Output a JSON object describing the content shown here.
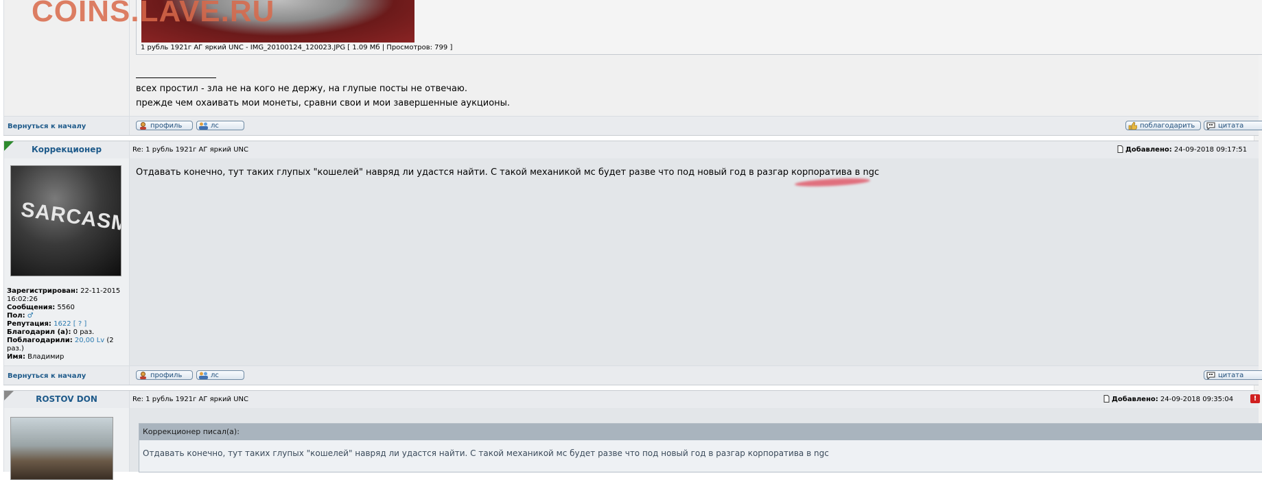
{
  "site": {
    "watermark": "COINS.LAVE.RU",
    "back_to_top": "Вернуться к началу"
  },
  "colors": {
    "accent": "#1e5a8a",
    "link": "#2a7ab0",
    "watermark": "#d9694a"
  },
  "first_post": {
    "attachment_caption": "1 рубль 1921г АГ яркий UNC - IMG_20100124_120023.JPG [ 1.09 Мб | Просмотров: 799 ]",
    "signature_rule": "____________________",
    "signature_line1": "всех простил - зла не на кого не держу, на глупые посты не отвечаю.",
    "signature_line2": "прежде чем охаивать мои монеты, сравни свои и мои завершенные аукционы.",
    "buttons": {
      "profile": "профиль",
      "pm": "лс",
      "thank": "поблагодарить",
      "quote": "цитата"
    }
  },
  "second_post": {
    "author": "Коррекционер",
    "subject": "Re: 1 рубль 1921г АГ яркий UNC",
    "added_label": "Добавлено:",
    "added_value": "24-09-2018 09:17:51",
    "avatar_text": "SARCASM",
    "body": "Отдавать конечно, тут таких глупых \"кошелей\" навряд ли удастся найти. С такой механикой мс будет разве что под новый год в разгар корпоратива в ngc",
    "info": {
      "registered_label": "Зарегистрирован:",
      "registered_value": "22-11-2015 16:02:26",
      "messages_label": "Сообщения:",
      "messages_value": "5560",
      "gender_label": "Пол:",
      "gender_icon": "male-icon",
      "reputation_label": "Репутация:",
      "reputation_value": "1622",
      "reputation_help": "[ ? ]",
      "thanked_label": "Благодарил (а):",
      "thanked_value": "0 раз.",
      "got_thanks_label": "Поблагодарили:",
      "got_thanks_value": "20,00 Lv",
      "got_thanks_count": "(2 раз.)",
      "name_label": "Имя:",
      "name_value": "Владимир"
    },
    "buttons": {
      "profile": "профиль",
      "pm": "лс",
      "quote": "цитата"
    }
  },
  "third_post": {
    "author": "ROSTOV DON",
    "subject": "Re: 1 рубль 1921г АГ яркий UNC",
    "added_label": "Добавлено:",
    "added_value": "24-09-2018 09:35:04",
    "quote_header": "Коррекционер писал(а):",
    "quote_text": "Отдавать конечно, тут таких глупых \"кошелей\" навряд ли удастся найти. С такой механикой мс будет разве что под новый год в разгар корпоратива в ngc"
  }
}
